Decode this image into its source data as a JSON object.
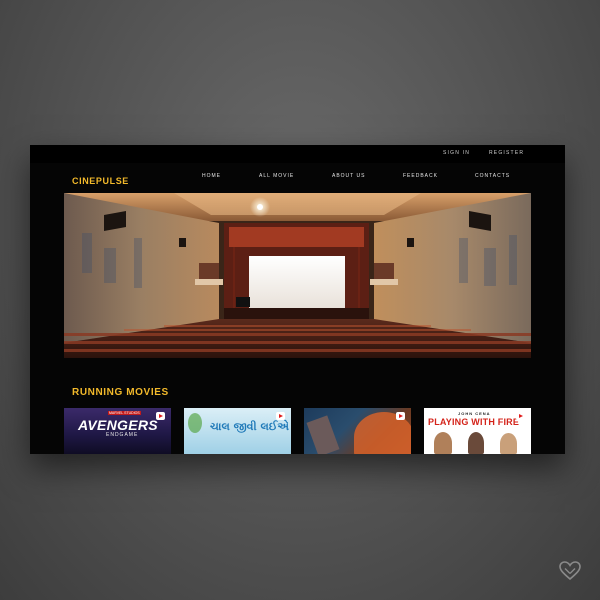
{
  "top_links": {
    "sign_in": "SIGN IN",
    "register": "REGISTER"
  },
  "brand": "CINEPULSE",
  "nav": [
    "HOME",
    "ALL MOVIE",
    "ABOUT US",
    "FEEDBACK",
    "CONTACTS"
  ],
  "section_title": "RUNNING MOVIES",
  "movies": [
    {
      "title": "AVENGERS",
      "subtitle": "ENDGAME",
      "badge": "MARVEL STUDIOS"
    },
    {
      "title": "ચાલ જીવી લઈએ"
    },
    {
      "title": ""
    },
    {
      "title": "PLAYING WITH FIRE",
      "top_text": "JOHN CENA"
    }
  ],
  "colors": {
    "accent": "#f2b92b",
    "frame_bg": "#050505",
    "play_red": "#e01c1c"
  },
  "icons": {
    "play": "play-icon",
    "heart": "heart-icon"
  }
}
